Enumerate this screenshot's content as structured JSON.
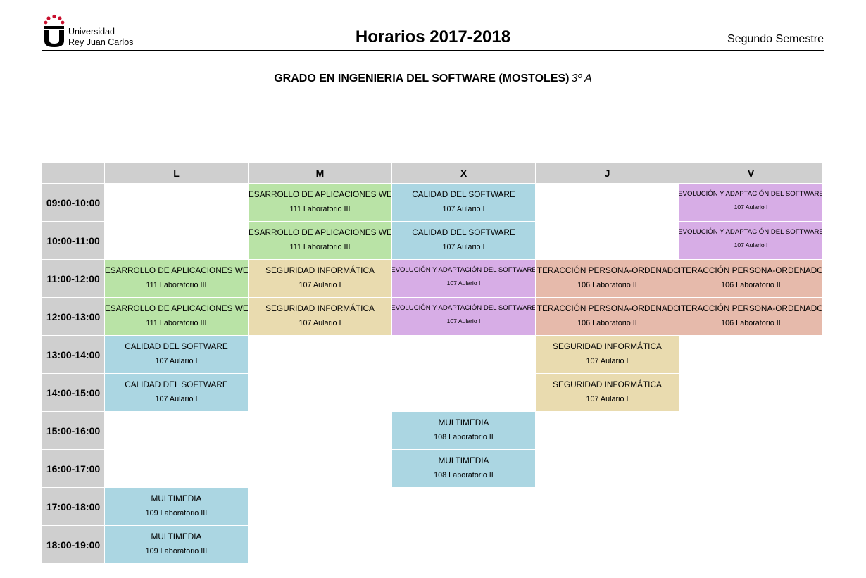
{
  "header": {
    "university_line1": "Universidad",
    "university_line2": "Rey Juan Carlos",
    "title": "Horarios 2017-2018",
    "semester": "Segundo Semestre",
    "degree": "GRADO EN INGENIERIA DEL SOFTWARE (MOSTOLES)",
    "group": "3º A"
  },
  "colors": {
    "logo_red": "#c8102e",
    "header_gray": "#cfcfcf",
    "green": "#b9e3a6",
    "blue": "#abd6e2",
    "tan": "#e9dbaf",
    "purple": "#d7ade6",
    "salmon": "#e6baab"
  },
  "days": [
    "L",
    "M",
    "X",
    "J",
    "V"
  ],
  "times": [
    "09:00-10:00",
    "10:00-11:00",
    "11:00-12:00",
    "12:00-13:00",
    "13:00-14:00",
    "14:00-15:00",
    "15:00-16:00",
    "16:00-17:00",
    "17:00-18:00",
    "18:00-19:00"
  ],
  "sessions": [
    {
      "day": 0,
      "slot": 2,
      "subject": "DESARROLLO DE APLICACIONES WEB",
      "room": "111 Laboratorio III",
      "color": "#b9e3a6",
      "small": false
    },
    {
      "day": 0,
      "slot": 3,
      "subject": "DESARROLLO DE APLICACIONES WEB",
      "room": "111 Laboratorio III",
      "color": "#b9e3a6",
      "small": false
    },
    {
      "day": 0,
      "slot": 4,
      "subject": "CALIDAD DEL SOFTWARE",
      "room": "107 Aulario I",
      "color": "#abd6e2",
      "small": false
    },
    {
      "day": 0,
      "slot": 5,
      "subject": "CALIDAD DEL SOFTWARE",
      "room": "107 Aulario I",
      "color": "#abd6e2",
      "small": false
    },
    {
      "day": 0,
      "slot": 8,
      "subject": "MULTIMEDIA",
      "room": "109 Laboratorio III",
      "color": "#abd6e2",
      "small": false
    },
    {
      "day": 0,
      "slot": 9,
      "subject": "MULTIMEDIA",
      "room": "109 Laboratorio III",
      "color": "#abd6e2",
      "small": false
    },
    {
      "day": 1,
      "slot": 0,
      "subject": "DESARROLLO DE APLICACIONES WEB",
      "room": "111 Laboratorio III",
      "color": "#b9e3a6",
      "small": false
    },
    {
      "day": 1,
      "slot": 1,
      "subject": "DESARROLLO DE APLICACIONES WEB",
      "room": "111 Laboratorio III",
      "color": "#b9e3a6",
      "small": false
    },
    {
      "day": 1,
      "slot": 2,
      "subject": "SEGURIDAD INFORMÁTICA",
      "room": "107 Aulario I",
      "color": "#e9dbaf",
      "small": false
    },
    {
      "day": 1,
      "slot": 3,
      "subject": "SEGURIDAD INFORMÁTICA",
      "room": "107 Aulario I",
      "color": "#e9dbaf",
      "small": false
    },
    {
      "day": 2,
      "slot": 0,
      "subject": "CALIDAD DEL SOFTWARE",
      "room": "107 Aulario I",
      "color": "#abd6e2",
      "small": false
    },
    {
      "day": 2,
      "slot": 1,
      "subject": "CALIDAD DEL SOFTWARE",
      "room": "107 Aulario I",
      "color": "#abd6e2",
      "small": false
    },
    {
      "day": 2,
      "slot": 2,
      "subject": "EVOLUCIÓN Y ADAPTACIÓN DEL SOFTWARE",
      "room": "107 Aulario I",
      "color": "#d7ade6",
      "small": true
    },
    {
      "day": 2,
      "slot": 3,
      "subject": "EVOLUCIÓN Y ADAPTACIÓN DEL SOFTWARE",
      "room": "107 Aulario I",
      "color": "#d7ade6",
      "small": true
    },
    {
      "day": 2,
      "slot": 6,
      "subject": "MULTIMEDIA",
      "room": "108 Laboratorio II",
      "color": "#abd6e2",
      "small": false
    },
    {
      "day": 2,
      "slot": 7,
      "subject": "MULTIMEDIA",
      "room": "108 Laboratorio II",
      "color": "#abd6e2",
      "small": false
    },
    {
      "day": 3,
      "slot": 2,
      "subject": "INTERACCIÓN PERSONA-ORDENADOR",
      "room": "106 Laboratorio II",
      "color": "#e6baab",
      "small": false
    },
    {
      "day": 3,
      "slot": 3,
      "subject": "INTERACCIÓN PERSONA-ORDENADOR",
      "room": "106 Laboratorio II",
      "color": "#e6baab",
      "small": false
    },
    {
      "day": 3,
      "slot": 4,
      "subject": "SEGURIDAD INFORMÁTICA",
      "room": "107 Aulario I",
      "color": "#e9dbaf",
      "small": false
    },
    {
      "day": 3,
      "slot": 5,
      "subject": "SEGURIDAD INFORMÁTICA",
      "room": "107 Aulario I",
      "color": "#e9dbaf",
      "small": false
    },
    {
      "day": 4,
      "slot": 0,
      "subject": "EVOLUCIÓN Y ADAPTACIÓN DEL SOFTWARE",
      "room": "107 Aulario I",
      "color": "#d7ade6",
      "small": true
    },
    {
      "day": 4,
      "slot": 1,
      "subject": "EVOLUCIÓN Y ADAPTACIÓN DEL SOFTWARE",
      "room": "107 Aulario I",
      "color": "#d7ade6",
      "small": true
    },
    {
      "day": 4,
      "slot": 2,
      "subject": "INTERACCIÓN PERSONA-ORDENADOR",
      "room": "106 Laboratorio II",
      "color": "#e6baab",
      "small": false
    },
    {
      "day": 4,
      "slot": 3,
      "subject": "INTERACCIÓN PERSONA-ORDENADOR",
      "room": "106 Laboratorio II",
      "color": "#e6baab",
      "small": false
    }
  ]
}
